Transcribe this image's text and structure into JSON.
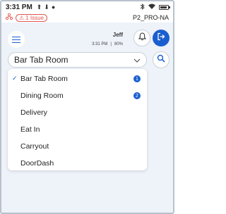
{
  "status_bar": {
    "time": "3:31 PM",
    "notification_icons": [
      "upload-icon",
      "download-icon",
      "location-icon"
    ],
    "system_icons": [
      "bluetooth-icon",
      "wifi-icon",
      "battery-icon"
    ]
  },
  "info_strip": {
    "issue_badge_label": "1 Issue",
    "device_id": "P2_PRO-NA"
  },
  "header": {
    "user_name": "Jeff",
    "user_time": "3:31 PM",
    "battery_text": "80%"
  },
  "selector": {
    "selected_value": "Bar Tab Room"
  },
  "dropdown": {
    "items": [
      {
        "label": "Bar Tab Room",
        "selected": true,
        "count": "1"
      },
      {
        "label": "Dining Room",
        "selected": false,
        "count": "2"
      },
      {
        "label": "Delivery",
        "selected": false,
        "count": ""
      },
      {
        "label": "Eat In",
        "selected": false,
        "count": ""
      },
      {
        "label": "Carryout",
        "selected": false,
        "count": ""
      },
      {
        "label": "DoorDash",
        "selected": false,
        "count": ""
      }
    ],
    "check_glyph": "✓"
  },
  "colors": {
    "accent": "#1a5fcf",
    "alert": "#e0584f",
    "background": "#eef2f9"
  }
}
